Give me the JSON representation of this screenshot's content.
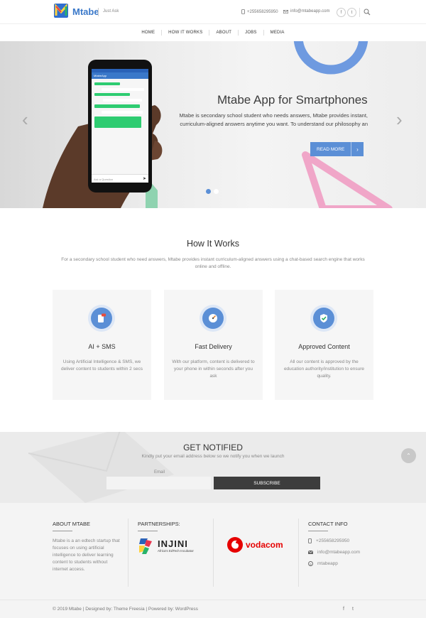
{
  "header": {
    "logo_letter": "M",
    "logo_text": "Mtabe",
    "tagline": "Just Ask",
    "phone": "+255658295950",
    "email": "info@mtabeapp.com",
    "social": [
      "f",
      "t"
    ]
  },
  "nav": {
    "items": [
      "HOME",
      "HOW IT WORKS",
      "ABOUT",
      "JOBS",
      "MEDIA"
    ]
  },
  "hero": {
    "title": "Mtabe App for Smartphones",
    "text": "Mtabe is secondary school student who needs answers, Mtabe provides instant, curriculum-aligned answers anytime you want.   To understand our philosophy an",
    "button_label": "READ MORE",
    "button_icon": "chevron-right",
    "phone_app_name": "MtabeApp",
    "phone_input_placeholder": "Ask a Question",
    "slides": 2,
    "active_slide": 1
  },
  "how_it_works": {
    "title": "How It Works",
    "description": "For a secondary school student who need answers, Mtabe provides instant curriculum-aligned answers using a chat-based search engine that works online and offline.",
    "cards": [
      {
        "title": "AI + SMS",
        "icon": "sms-icon",
        "text": "Using Artificial Intelligence & SMS, we deliver content to students within 2 secs"
      },
      {
        "title": "Fast Delivery",
        "icon": "speedometer-icon",
        "text": "With our platform, content is delivered to your phone in within seconds after you ask"
      },
      {
        "title": "Approved Content",
        "icon": "shield-check-icon",
        "text": "All our content is approved by the education authority/institution to ensure quality."
      }
    ]
  },
  "notify": {
    "title": "GET NOTIFIED",
    "subtitle": "Kindly put your email address below so we notify you when we launch",
    "email_label": "Email",
    "email_value": "",
    "button_label": "SUBSCRIBE"
  },
  "footer": {
    "about_heading": "ABOUT MTABE",
    "about_text": "Mtabe is a an edtech startup that focuses on using artificial intelligence to deliver learning content to students without internet access.",
    "partners_heading": "PARTNERSHIPS:",
    "partner1_name": "INJINI",
    "partner1_sub": "Africa's EdTech Incubator",
    "partner2_name": "vodacom",
    "contact_heading": "CONTACT INFO",
    "contact": [
      {
        "icon": "phone-icon",
        "text": "+255658295950"
      },
      {
        "icon": "mail-icon",
        "text": "info@mtabeapp.com"
      },
      {
        "icon": "skype-icon",
        "text": "mtabeapp"
      }
    ],
    "copyright": "© 2019 Mtabe | Designed by: Theme Freesia | Powered by: WordPress",
    "social": [
      "f",
      "t"
    ]
  },
  "colors": {
    "accent": "#5b8fd6",
    "dark": "#3d3d3d",
    "vodacom": "#e60000",
    "hero_pink": "#f0a6c8"
  }
}
